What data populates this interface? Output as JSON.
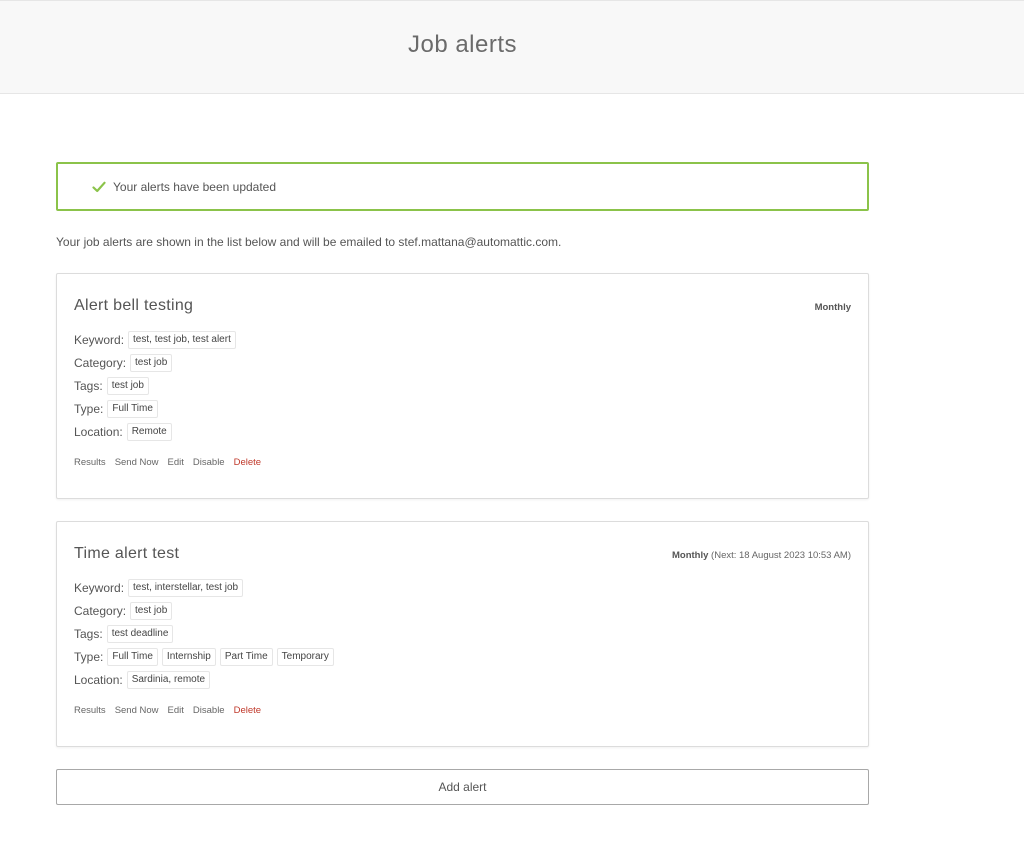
{
  "header": {
    "title": "Job alerts"
  },
  "notice": {
    "text": "Your alerts have been updated",
    "color": "#8bc34a"
  },
  "intro": "Your job alerts are shown in the list below and will be emailed to stef.mattana@automattic.com.",
  "alerts": [
    {
      "name": "Alert bell testing",
      "frequency": "Monthly",
      "next": "",
      "keyword_label": "Keyword:",
      "keywords": [
        "test, test job, test alert"
      ],
      "category_label": "Category:",
      "categories": [
        "test job"
      ],
      "tags_label": "Tags:",
      "tags": [
        "test job"
      ],
      "type_label": "Type:",
      "types": [
        "Full Time"
      ],
      "location_label": "Location:",
      "locations": [
        "Remote"
      ],
      "actions": {
        "results": "Results",
        "send_now": "Send Now",
        "edit": "Edit",
        "disable": "Disable",
        "delete": "Delete"
      }
    },
    {
      "name": "Time alert test",
      "frequency": "Monthly",
      "next": "(Next: 18 August 2023 10:53 AM)",
      "keyword_label": "Keyword:",
      "keywords": [
        "test, interstellar, test job"
      ],
      "category_label": "Category:",
      "categories": [
        "test job"
      ],
      "tags_label": "Tags:",
      "tags": [
        "test deadline"
      ],
      "type_label": "Type:",
      "types": [
        "Full Time",
        "Internship",
        "Part Time",
        "Temporary"
      ],
      "location_label": "Location:",
      "locations": [
        "Sardinia, remote"
      ],
      "actions": {
        "results": "Results",
        "send_now": "Send Now",
        "edit": "Edit",
        "disable": "Disable",
        "delete": "Delete"
      }
    }
  ],
  "add_alert": "Add alert",
  "colors": {
    "delete": "#c0392b",
    "border": "#dcdcdc",
    "header_bg": "#f8f8f8"
  }
}
